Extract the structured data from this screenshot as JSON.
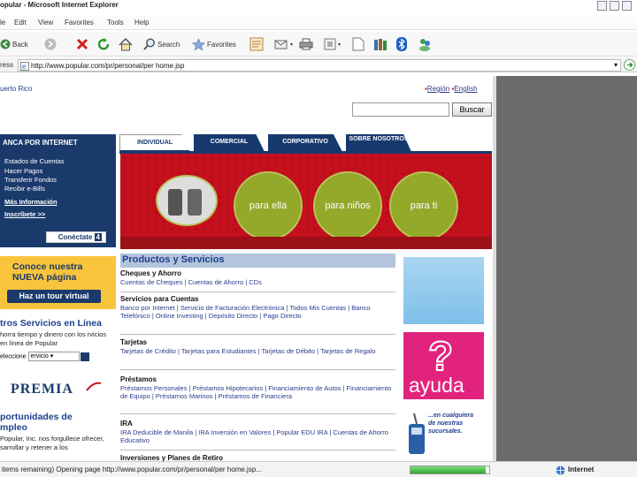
{
  "window": {
    "title": "opular - Microsoft Internet Explorer"
  },
  "menu": [
    "le",
    "Edit",
    "View",
    "Favorites",
    "Tools",
    "Help"
  ],
  "toolbar": {
    "back": "Back",
    "search": "Search",
    "favorites": "Favorites"
  },
  "address": {
    "label": "ress",
    "url": "http://www.popular.com/pr/personal/per home.jsp"
  },
  "page": {
    "region": "uerto Rico",
    "region_link": "Región",
    "english_link": "English",
    "search_placeholder": "",
    "search_button": "Buscar",
    "tabs": [
      {
        "label": "INDIVIDUAL",
        "active": true
      },
      {
        "label": "COMERCIAL",
        "active": false
      },
      {
        "label": "CORPORATIVO",
        "active": false
      },
      {
        "label": "SOBRE NOSOTROS",
        "active": false
      }
    ],
    "banana": "",
    "banner": {
      "circles": [
        "para ella",
        "para niños",
        "para ti"
      ]
    },
    "internet_box": {
      "heading": "ANCA POR INTERNET",
      "items": [
        "Estados de Cuentas",
        "Hacer Pagos",
        "Transferir Fondos",
        "Recibir e-Bills"
      ],
      "more_info": "Más Información",
      "register": "Inscríbete >>",
      "connect_button": "Conéctate",
      "connect_num": "4"
    },
    "tour": {
      "line1": "Conoce nuestra",
      "line2": "NUEVA página",
      "button": "Haz un tour virtual"
    },
    "online": {
      "heading": "tros Servicios en Línea",
      "text": "horra tiempo y dinero con los rvicios en línea de Popular",
      "select_label": "eleccione",
      "select_value": "ervicio"
    },
    "premia": "PREMIA",
    "opportunities": {
      "heading1": "portunidades de",
      "heading2": "mpleo",
      "text": "Popular, Inc. nos forgullece ofrecer, sarrollar y retener a los"
    },
    "products": {
      "title": "Productos y Servicios",
      "sections": [
        {
          "heading": "Cheques y Ahorro",
          "links": "Cuentas de Cheques | Cuentas de Ahorro | CDs"
        },
        {
          "heading": "Servicios para Cuentas",
          "links": "Banco por Internet | Servicio de Facturación Electrónica | Todos Mis Cuentas | Banco Telefónico | Online Investing | Depósito Directo | Pago Directo"
        },
        {
          "heading": "Tarjetas",
          "links": "Tarjetas de Crédito | Tarjetas para Estudiantes | Tarjetas de Débito | Tarjetas de Regalo"
        },
        {
          "heading": "Préstamos",
          "links": "Préstamos Personales | Préstamos Hipotecarios | Financiamiento de Autos | Financiamiento de Equipo | Préstamos Marinos | Préstamos de Financiera"
        },
        {
          "heading": "IRA",
          "links": "IRA Deducible de Manila | IRA Inversión en Valores | Popular EDU IRA | Cuentas de Ahorro Educativo"
        },
        {
          "heading": "Inversiones y Planes de Retiro",
          "links": ""
        }
      ]
    },
    "ayuda": "ayuda",
    "extension": {
      "line1": "...en cualquiera",
      "line2": "de nuestras",
      "line3": "sucursales."
    }
  },
  "status": {
    "text": "items remaining) Opening page http://www.popular.com/pr/personal/per home.jsp...",
    "progress": 0.95,
    "zone": "Internet"
  }
}
